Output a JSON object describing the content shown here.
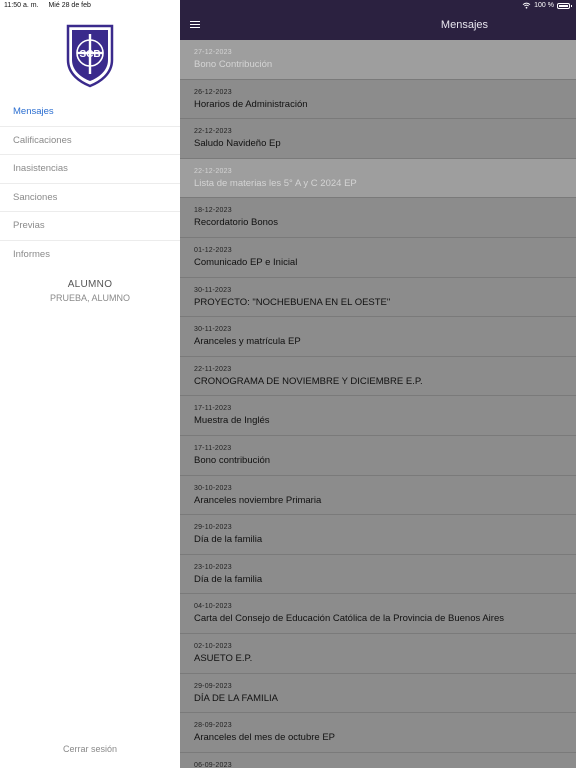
{
  "status_bar": {
    "time": "11:50 a. m.",
    "date": "Mié 28 de feb",
    "battery": "100 %"
  },
  "sidebar": {
    "menu": [
      "Mensajes",
      "Calificaciones",
      "Inasistencias",
      "Sanciones",
      "Previas",
      "Informes"
    ],
    "student_role": "ALUMNO",
    "student_name": "PRUEBA, ALUMNO",
    "logout": "Cerrar sesión"
  },
  "logo_text": "SCB",
  "header": {
    "title": "Mensajes"
  },
  "messages": [
    {
      "date": "27-12-2023",
      "title": "Bono Contribución",
      "read": true
    },
    {
      "date": "26-12-2023",
      "title": "Horarios de Administración",
      "read": false
    },
    {
      "date": "22-12-2023",
      "title": "Saludo Navideño Ep",
      "read": false
    },
    {
      "date": "22-12-2023",
      "title": "Lista de materias les 5° A y C 2024 EP",
      "read": true
    },
    {
      "date": "18-12-2023",
      "title": "Recordatorio Bonos",
      "read": false
    },
    {
      "date": "01-12-2023",
      "title": "Comunicado EP e Inicial",
      "read": false
    },
    {
      "date": "30-11-2023",
      "title": "PROYECTO: \"NOCHEBUENA EN EL OESTE\"",
      "read": false
    },
    {
      "date": "30-11-2023",
      "title": "Aranceles y matrícula EP",
      "read": false
    },
    {
      "date": "22-11-2023",
      "title": "CRONOGRAMA DE NOVIEMBRE Y DICIEMBRE E.P.",
      "read": false
    },
    {
      "date": "17-11-2023",
      "title": "Muestra de Inglés",
      "read": false
    },
    {
      "date": "17-11-2023",
      "title": "Bono contribución",
      "read": false
    },
    {
      "date": "30-10-2023",
      "title": "Aranceles noviembre Primaria",
      "read": false
    },
    {
      "date": "29-10-2023",
      "title": "Día de la familia",
      "read": false
    },
    {
      "date": "23-10-2023",
      "title": "Día de la familia",
      "read": false
    },
    {
      "date": "04-10-2023",
      "title": "Carta del Consejo de Educación Católica de la Provincia de Buenos Aires",
      "read": false
    },
    {
      "date": "02-10-2023",
      "title": "ASUETO E.P.",
      "read": false
    },
    {
      "date": "29-09-2023",
      "title": "DÍA DE LA FAMILIA",
      "read": false
    },
    {
      "date": "28-09-2023",
      "title": "Aranceles del mes de octubre EP",
      "read": false
    },
    {
      "date": "06-09-2023",
      "title": "",
      "read": false
    }
  ],
  "colors": {
    "header_bg": "#2b2140",
    "logo_purple": "#3a2a8c",
    "active_menu": "#2c6fd1"
  }
}
